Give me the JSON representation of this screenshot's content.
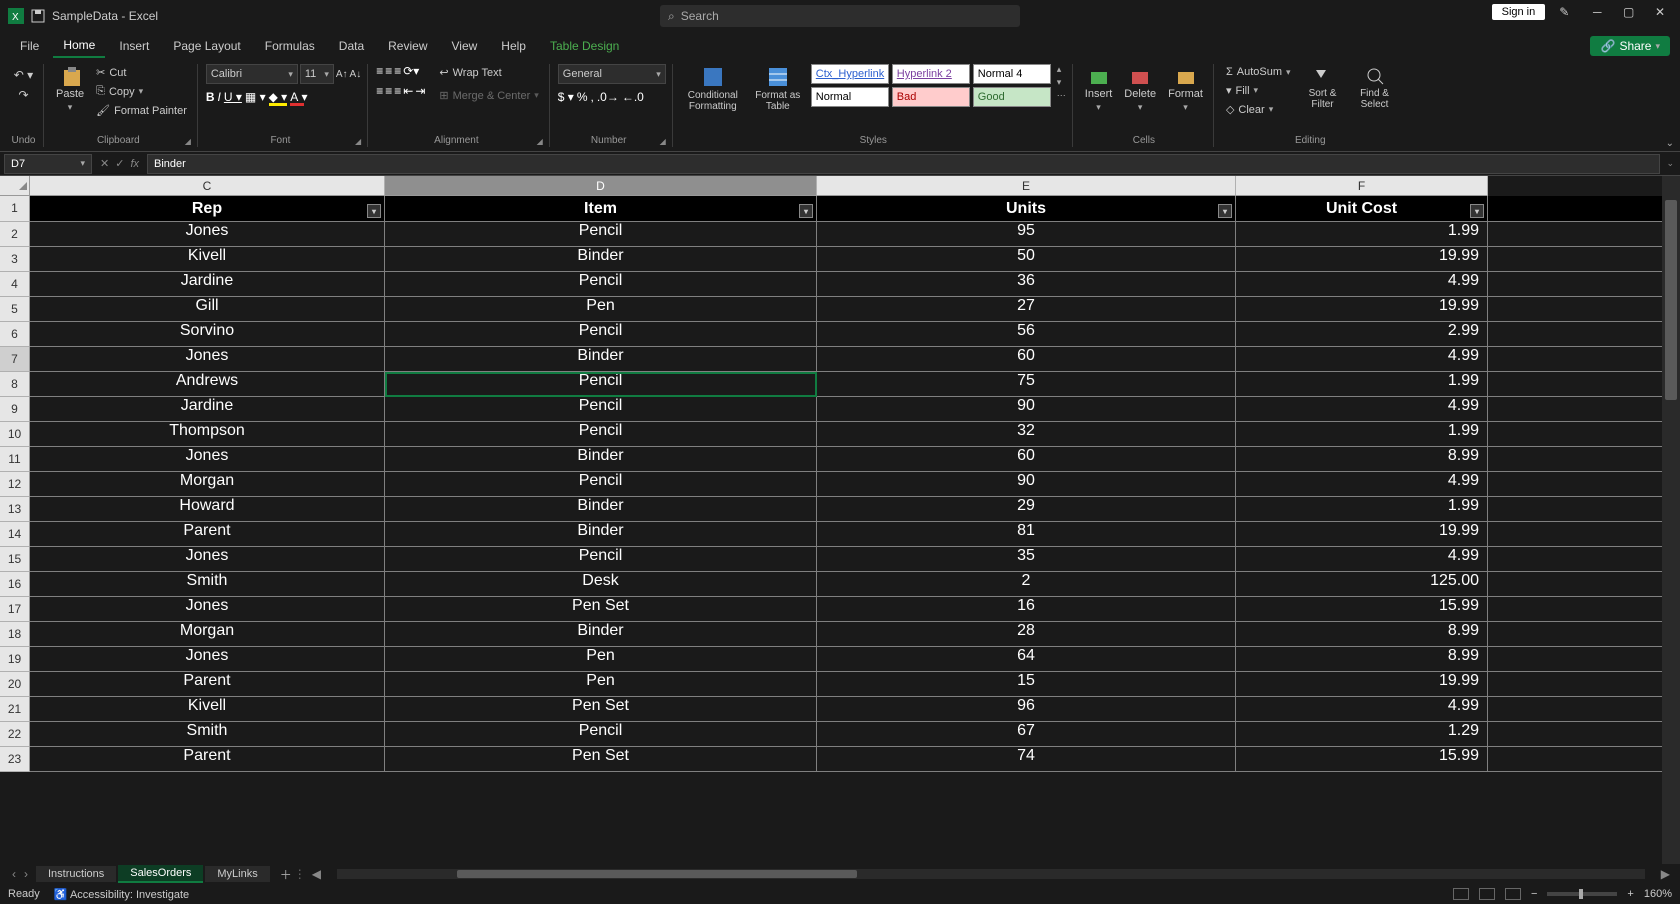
{
  "titlebar": {
    "title": "SampleData - Excel",
    "search_placeholder": "Search",
    "signin": "Sign in"
  },
  "tabs": {
    "file": "File",
    "home": "Home",
    "insert": "Insert",
    "page_layout": "Page Layout",
    "formulas": "Formulas",
    "data": "Data",
    "review": "Review",
    "view": "View",
    "help": "Help",
    "table_design": "Table Design",
    "share": "Share"
  },
  "ribbon": {
    "undo": "Undo",
    "paste": "Paste",
    "cut": "Cut",
    "copy": "Copy",
    "format_painter": "Format Painter",
    "clipboard": "Clipboard",
    "font_name": "Calibri",
    "font_size": "11",
    "font": "Font",
    "wrap": "Wrap Text",
    "merge": "Merge & Center",
    "alignment": "Alignment",
    "number_format": "General",
    "number": "Number",
    "cond_fmt": "Conditional Formatting",
    "fmt_table": "Format as Table",
    "styles": "Styles",
    "style_ctx": "Ctx_Hyperlink",
    "style_hl2": "Hyperlink 2",
    "style_n4": "Normal 4",
    "style_normal": "Normal",
    "style_bad": "Bad",
    "style_good": "Good",
    "insert": "Insert",
    "delete": "Delete",
    "format": "Format",
    "cells": "Cells",
    "autosum": "AutoSum",
    "fill": "Fill",
    "clear": "Clear",
    "sort_filter": "Sort & Filter",
    "find_select": "Find & Select",
    "editing": "Editing"
  },
  "namebox": {
    "cell": "D7",
    "formula": "Binder"
  },
  "columns": {
    "C": "C",
    "D": "D",
    "E": "E",
    "F": "F"
  },
  "headers": {
    "rep": "Rep",
    "item": "Item",
    "units": "Units",
    "unitcost": "Unit Cost"
  },
  "rows": [
    {
      "rep": "Jones",
      "item": "Pencil",
      "units": "95",
      "cost": "1.99"
    },
    {
      "rep": "Kivell",
      "item": "Binder",
      "units": "50",
      "cost": "19.99"
    },
    {
      "rep": "Jardine",
      "item": "Pencil",
      "units": "36",
      "cost": "4.99"
    },
    {
      "rep": "Gill",
      "item": "Pen",
      "units": "27",
      "cost": "19.99"
    },
    {
      "rep": "Sorvino",
      "item": "Pencil",
      "units": "56",
      "cost": "2.99"
    },
    {
      "rep": "Jones",
      "item": "Binder",
      "units": "60",
      "cost": "4.99"
    },
    {
      "rep": "Andrews",
      "item": "Pencil",
      "units": "75",
      "cost": "1.99"
    },
    {
      "rep": "Jardine",
      "item": "Pencil",
      "units": "90",
      "cost": "4.99"
    },
    {
      "rep": "Thompson",
      "item": "Pencil",
      "units": "32",
      "cost": "1.99"
    },
    {
      "rep": "Jones",
      "item": "Binder",
      "units": "60",
      "cost": "8.99"
    },
    {
      "rep": "Morgan",
      "item": "Pencil",
      "units": "90",
      "cost": "4.99"
    },
    {
      "rep": "Howard",
      "item": "Binder",
      "units": "29",
      "cost": "1.99"
    },
    {
      "rep": "Parent",
      "item": "Binder",
      "units": "81",
      "cost": "19.99"
    },
    {
      "rep": "Jones",
      "item": "Pencil",
      "units": "35",
      "cost": "4.99"
    },
    {
      "rep": "Smith",
      "item": "Desk",
      "units": "2",
      "cost": "125.00"
    },
    {
      "rep": "Jones",
      "item": "Pen Set",
      "units": "16",
      "cost": "15.99"
    },
    {
      "rep": "Morgan",
      "item": "Binder",
      "units": "28",
      "cost": "8.99"
    },
    {
      "rep": "Jones",
      "item": "Pen",
      "units": "64",
      "cost": "8.99"
    },
    {
      "rep": "Parent",
      "item": "Pen",
      "units": "15",
      "cost": "19.99"
    },
    {
      "rep": "Kivell",
      "item": "Pen Set",
      "units": "96",
      "cost": "4.99"
    },
    {
      "rep": "Smith",
      "item": "Pencil",
      "units": "67",
      "cost": "1.29"
    },
    {
      "rep": "Parent",
      "item": "Pen Set",
      "units": "74",
      "cost": "15.99"
    }
  ],
  "sheet_tabs": {
    "t1": "Instructions",
    "t2": "SalesOrders",
    "t3": "MyLinks"
  },
  "status": {
    "ready": "Ready",
    "acc": "Accessibility: Investigate",
    "zoom": "160%"
  }
}
